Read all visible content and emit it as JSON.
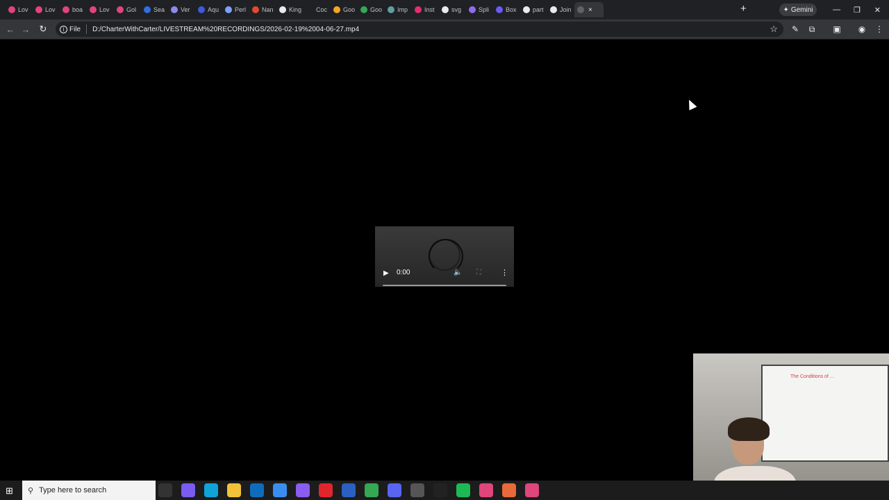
{
  "browser": {
    "tabs": [
      {
        "label": "Lov",
        "color": "#e0457b"
      },
      {
        "label": "Lov",
        "color": "#e0457b"
      },
      {
        "label": "boa",
        "color": "#e0457b"
      },
      {
        "label": "Lov",
        "color": "#e0457b"
      },
      {
        "label": "Gol",
        "color": "#e0457b"
      },
      {
        "label": "Sea",
        "color": "#2f6fe4"
      },
      {
        "label": "Ver",
        "color": "#8a8af0"
      },
      {
        "label": "Aqu",
        "color": "#3b5bdb"
      },
      {
        "label": "Perl",
        "color": "#7aa2ff"
      },
      {
        "label": "Nan",
        "color": "#e04a2f"
      },
      {
        "label": "King",
        "color": "#e8eaed"
      },
      {
        "label": "Coc",
        "color": "#202124"
      },
      {
        "label": "Goo",
        "color": "#f5a623"
      },
      {
        "label": "Goo",
        "color": "#34a853"
      },
      {
        "label": "Imp",
        "color": "#5f9ea0"
      },
      {
        "label": "Inst",
        "color": "#e1306c"
      },
      {
        "label": "svg",
        "color": "#e8eaed"
      },
      {
        "label": "Spli",
        "color": "#8e6cf0"
      },
      {
        "label": "Box",
        "color": "#6a5cf0"
      },
      {
        "label": "part",
        "color": "#e8eaed"
      },
      {
        "label": "Join",
        "color": "#e8eaed"
      }
    ],
    "active_tab_close": "×",
    "new_tab_label": "+",
    "gemini_label": "Gemini",
    "window_controls": {
      "minimize": "—",
      "restore": "❐",
      "close": "✕"
    },
    "file_chip": "File",
    "url": "D:/CharterWithCarter/LIVESTREAM%20RECORDINGS/2026-02-19%2004-06-27.mp4"
  },
  "player": {
    "time": "0:00",
    "progress": 0
  },
  "webcam": {
    "whiteboard_title": "The Conditions of ..."
  },
  "taskbar": {
    "search_placeholder": "Type here to search",
    "apps": [
      {
        "name": "task-view",
        "color": "#333333"
      },
      {
        "name": "copilot",
        "color": "#7a5cf0"
      },
      {
        "name": "edge",
        "color": "#0fa3d8"
      },
      {
        "name": "file-explorer",
        "color": "#f3c13a"
      },
      {
        "name": "outlook",
        "color": "#0f6cbd"
      },
      {
        "name": "store",
        "color": "#3a8df0"
      },
      {
        "name": "copilot-2",
        "color": "#8a5cf0"
      },
      {
        "name": "opera",
        "color": "#e0262c"
      },
      {
        "name": "app-blue",
        "color": "#2b5fc1"
      },
      {
        "name": "chrome",
        "color": "#34a853"
      },
      {
        "name": "discord",
        "color": "#5865f2"
      },
      {
        "name": "app-circle",
        "color": "#555555"
      },
      {
        "name": "app-g",
        "color": "#222222"
      },
      {
        "name": "spotify",
        "color": "#1db954"
      },
      {
        "name": "chrome-active",
        "color": "#e0457b"
      },
      {
        "name": "app-orange",
        "color": "#e86a3a"
      },
      {
        "name": "app-pink",
        "color": "#e0457b"
      }
    ]
  }
}
